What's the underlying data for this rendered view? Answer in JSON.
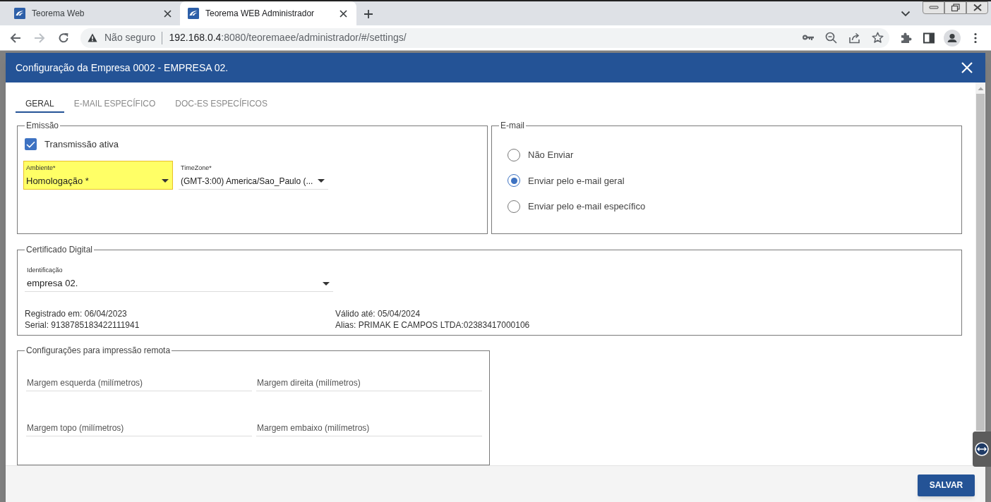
{
  "browser": {
    "tabs": [
      {
        "title": "Teorema Web",
        "selected": false
      },
      {
        "title": "Teorema WEB Administrador",
        "selected": true
      }
    ],
    "nav_buttons": [
      {
        "kind": "back",
        "disabled": false
      },
      {
        "kind": "forward",
        "disabled": true
      },
      {
        "kind": "reload",
        "disabled": false
      }
    ],
    "address_bar": {
      "security_label": "Não seguro",
      "host": "192.168.0.4",
      "path": ":8080/teoremaee/administrador/#/settings/"
    }
  },
  "dialog": {
    "title": "Configuração da Empresa 0002 - EMPRESA 02.",
    "tabs": [
      {
        "label": "GERAL",
        "selected": true
      },
      {
        "label": "E-MAIL ESPECÍFICO",
        "selected": false
      },
      {
        "label": "DOC-ES ESPECÍFICOS",
        "selected": false
      }
    ],
    "emissao": {
      "legend": "Emissão",
      "transmission": {
        "label": "Transmissão ativa",
        "checked": true
      },
      "selects": [
        {
          "label": "Ambiente*",
          "value": "Homologação *",
          "highlighted": true
        },
        {
          "label": "TimeZone*",
          "value": "(GMT-3:00) America/Sao_Paulo (...",
          "highlighted": false
        }
      ]
    },
    "email": {
      "legend": "E-mail",
      "options": [
        {
          "label": "Não Enviar",
          "selected": false
        },
        {
          "label": "Enviar pelo e-mail geral",
          "selected": true
        },
        {
          "label": "Enviar pelo e-mail específico",
          "selected": false
        }
      ]
    },
    "certificado": {
      "legend": "Certificado Digital",
      "select": {
        "label": "Identificação",
        "value": "empresa 02."
      },
      "details": [
        {
          "lines": [
            "Registrado em: 06/04/2023",
            "Serial: 9138785183422111941"
          ]
        },
        {
          "lines": [
            "Válido até: 05/04/2024",
            "Alias: PRIMAK E CAMPOS LTDA:02383417000106"
          ]
        }
      ]
    },
    "impressao": {
      "legend": "Configurações para impressão remota",
      "fields": [
        {
          "placeholder": "Margem esquerda (milímetros)"
        },
        {
          "placeholder": "Margem direita (milímetros)"
        },
        {
          "placeholder": "Margem topo (milímetros)"
        },
        {
          "placeholder": "Margem embaixo (milímetros)"
        }
      ]
    },
    "footer": {
      "buttons": [
        "SALVAR"
      ]
    }
  }
}
